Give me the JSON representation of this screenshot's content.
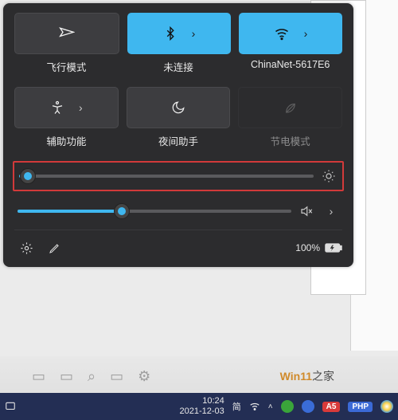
{
  "tiles": {
    "row1": [
      {
        "name": "airplane-mode-tile",
        "label": "飞行模式",
        "state": "off",
        "icon": "airplane",
        "expandable": false
      },
      {
        "name": "bluetooth-tile",
        "label": "未连接",
        "state": "on",
        "icon": "bluetooth",
        "expandable": true
      },
      {
        "name": "wifi-tile",
        "label": "ChinaNet-5617E6",
        "state": "on",
        "icon": "wifi",
        "expandable": true
      }
    ],
    "row2": [
      {
        "name": "accessibility-tile",
        "label": "辅助功能",
        "state": "off",
        "icon": "accessibility",
        "expandable": true
      },
      {
        "name": "night-light-tile",
        "label": "夜间助手",
        "state": "off",
        "icon": "moon",
        "expandable": false
      },
      {
        "name": "battery-saver-tile",
        "label": "节电模式",
        "state": "disabled",
        "icon": "leaf",
        "expandable": false
      }
    ]
  },
  "sliders": {
    "brightness": {
      "value": 3,
      "icon": "sun",
      "highlight": true
    },
    "volume": {
      "value": 38,
      "icon": "speaker-muted",
      "expandable": true
    }
  },
  "footer": {
    "settings_icon": "gear",
    "edit_icon": "pencil",
    "battery_text": "100%",
    "battery_icon": "battery-charging"
  },
  "taskbar_fade": {
    "watermark": "Win11",
    "watermark_suffix": "之家"
  },
  "taskbar": {
    "clock_time": "10:24",
    "clock_date": "2021-12-03",
    "cn_ime": "简",
    "badges": [
      "PHP",
      "A5"
    ]
  },
  "colors": {
    "panel_bg": "#2c2c2e",
    "tile_on": "#3fb7ef",
    "tile_off": "#3d3d40",
    "highlight_box": "#d23a3a",
    "taskbar_bg": "#232e54"
  }
}
